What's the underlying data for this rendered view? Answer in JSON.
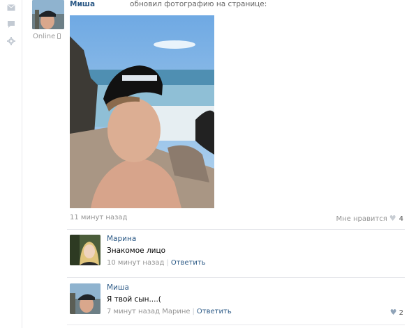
{
  "left_rail": {
    "icons": [
      "message-icon",
      "comment-icon",
      "gear-icon"
    ]
  },
  "author": {
    "name": "Миша",
    "status": "Online"
  },
  "post": {
    "action": "обновил фотографию на странице:",
    "time": "11 минут назад",
    "like_label": "Мне нравится",
    "like_count": "4"
  },
  "comments": [
    {
      "name": "Марина",
      "text": "Знакомое лицо",
      "time": "10 минут назад",
      "reply": "Ответить",
      "likes": ""
    },
    {
      "name": "Миша",
      "text": "Я твой сын....(",
      "time": "7 минут назад Марине",
      "reply": "Ответить",
      "likes": "2"
    }
  ],
  "colors": {
    "link": "#2a5885",
    "muted": "#939393",
    "divider": "#e7e8ec",
    "heart": "#c8cdd3"
  }
}
